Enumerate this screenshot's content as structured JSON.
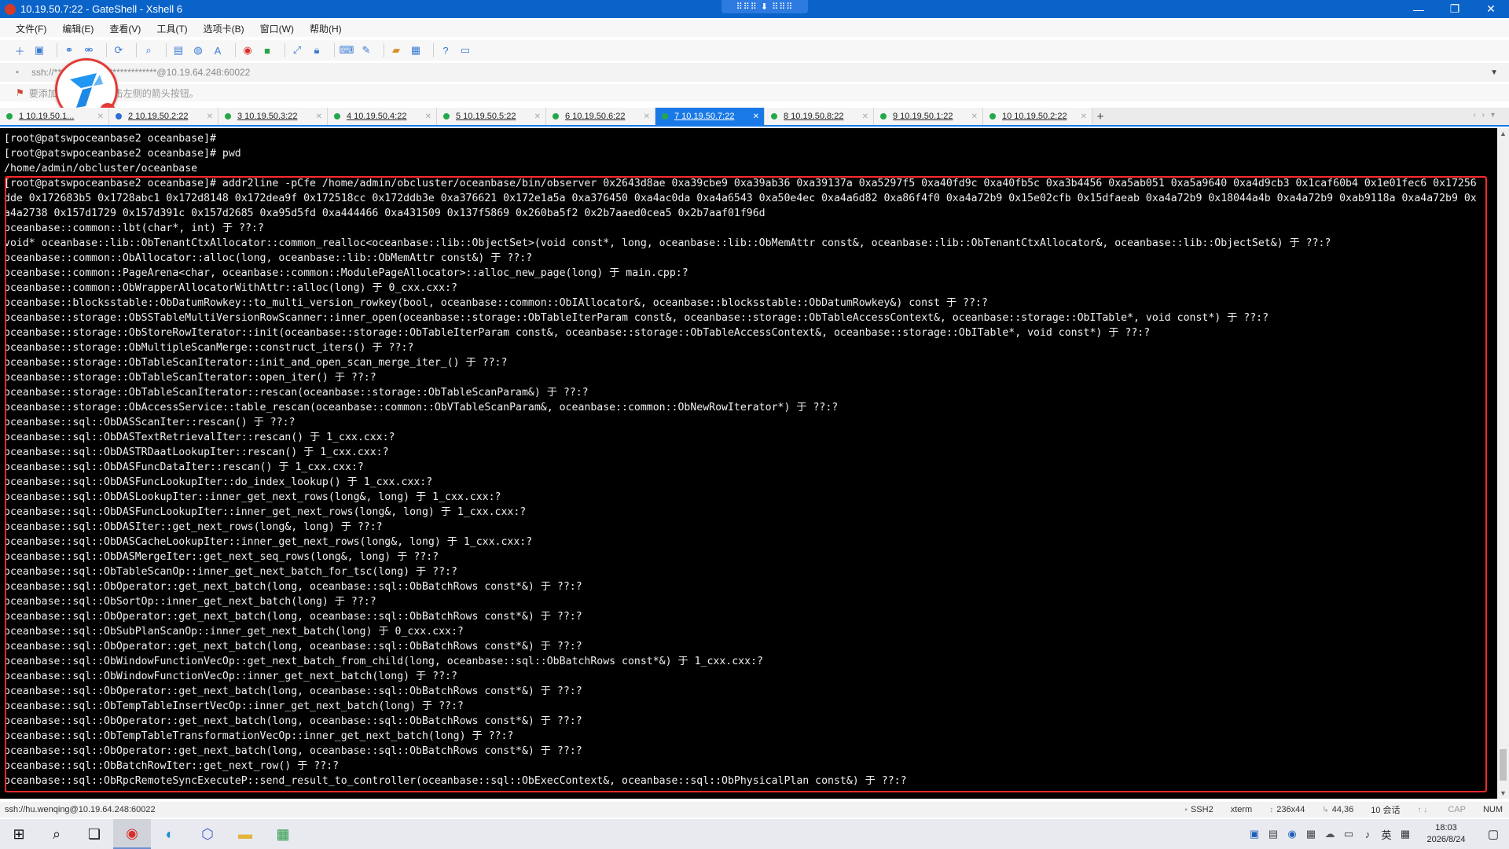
{
  "window": {
    "title": "10.19.50.7:22 - GateShell - Xshell 6",
    "grip": "⠿⠿⠿ ⬇ ⠿⠿⠿",
    "controls": [
      "—",
      "❐",
      "✕"
    ]
  },
  "menu": [
    "文件(F)",
    "编辑(E)",
    "查看(V)",
    "工具(T)",
    "选项卡(B)",
    "窗口(W)",
    "帮助(H)"
  ],
  "address": {
    "value": "ssh://****************************@10.19.64.248:60022"
  },
  "hint": {
    "text": "要添加当前会话，点击左侧的箭头按钮。"
  },
  "tabs": [
    {
      "label": "1 10.19.50.1...",
      "active": false,
      "warn": false
    },
    {
      "label": "2 10.19.50.2:22",
      "active": false,
      "warn": true
    },
    {
      "label": "3 10.19.50.3:22",
      "active": false,
      "warn": false
    },
    {
      "label": "4 10.19.50.4:22",
      "active": false,
      "warn": false
    },
    {
      "label": "5 10.19.50.5:22",
      "active": false,
      "warn": false
    },
    {
      "label": "6 10.19.50.6:22",
      "active": false,
      "warn": false
    },
    {
      "label": "7 10.19.50.7:22",
      "active": true,
      "warn": false
    },
    {
      "label": "8 10.19.50.8:22",
      "active": false,
      "warn": false
    },
    {
      "label": "9 10.19.50.1:22",
      "active": false,
      "warn": false
    },
    {
      "label": "10 10.19.50.2:22",
      "active": false,
      "warn": false
    }
  ],
  "terminal": {
    "lines": [
      "[root@patswpoceanbase2 oceanbase]#",
      "[root@patswpoceanbase2 oceanbase]# pwd",
      "/home/admin/obcluster/oceanbase",
      "[root@patswpoceanbase2 oceanbase]# addr2line -pCfe /home/admin/obcluster/oceanbase/bin/observer 0x2643d8ae 0xa39cbe9 0xa39ab36 0xa39137a 0xa5297f5 0xa40fd9c 0xa40fb5c 0xa3b4456 0xa5ab051 0xa5a9640 0xa4d9cb3 0x1caf60b4 0x1e01fec6 0x17256",
      "dde 0x172683b5 0x1728abc1 0x172d8148 0x172dea9f 0x172518cc 0x172ddb3e 0xa376621 0x172e1a5a 0xa376450 0xa4ac0da 0xa4a6543 0xa50e4ec 0xa4a6d82 0xa86f4f0 0xa4a72b9 0x15e02cfb 0x15dfaeab 0xa4a72b9 0x18044a4b 0xa4a72b9 0xab9118a 0xa4a72b9 0x",
      "a4a2738 0x157d1729 0x157d391c 0x157d2685 0xa95d5fd 0xa444466 0xa431509 0x137f5869 0x260ba5f2 0x2b7aaed0cea5 0x2b7aaf01f96d",
      "oceanbase::common::lbt(char*, int) 于 ??:?",
      "void* oceanbase::lib::ObTenantCtxAllocator::common_realloc<oceanbase::lib::ObjectSet>(void const*, long, oceanbase::lib::ObMemAttr const&, oceanbase::lib::ObTenantCtxAllocator&, oceanbase::lib::ObjectSet&) 于 ??:?",
      "oceanbase::common::ObAllocator::alloc(long, oceanbase::lib::ObMemAttr const&) 于 ??:?",
      "oceanbase::common::PageArena<char, oceanbase::common::ModulePageAllocator>::alloc_new_page(long) 于 main.cpp:?",
      "oceanbase::common::ObWrapperAllocatorWithAttr::alloc(long) 于 0_cxx.cxx:?",
      "oceanbase::blocksstable::ObDatumRowkey::to_multi_version_rowkey(bool, oceanbase::common::ObIAllocator&, oceanbase::blocksstable::ObDatumRowkey&) const 于 ??:?",
      "oceanbase::storage::ObSSTableMultiVersionRowScanner::inner_open(oceanbase::storage::ObTableIterParam const&, oceanbase::storage::ObTableAccessContext&, oceanbase::storage::ObITable*, void const*) 于 ??:?",
      "oceanbase::storage::ObStoreRowIterator::init(oceanbase::storage::ObTableIterParam const&, oceanbase::storage::ObTableAccessContext&, oceanbase::storage::ObITable*, void const*) 于 ??:?",
      "oceanbase::storage::ObMultipleScanMerge::construct_iters() 于 ??:?",
      "oceanbase::storage::ObTableScanIterator::init_and_open_scan_merge_iter_() 于 ??:?",
      "oceanbase::storage::ObTableScanIterator::open_iter() 于 ??:?",
      "oceanbase::storage::ObTableScanIterator::rescan(oceanbase::storage::ObTableScanParam&) 于 ??:?",
      "oceanbase::storage::ObAccessService::table_rescan(oceanbase::common::ObVTableScanParam&, oceanbase::common::ObNewRowIterator*) 于 ??:?",
      "oceanbase::sql::ObDASScanIter::rescan() 于 ??:?",
      "oceanbase::sql::ObDASTextRetrievalIter::rescan() 于 1_cxx.cxx:?",
      "oceanbase::sql::ObDASTRDaatLookupIter::rescan() 于 1_cxx.cxx:?",
      "oceanbase::sql::ObDASFuncDataIter::rescan() 于 1_cxx.cxx:?",
      "oceanbase::sql::ObDASFuncLookupIter::do_index_lookup() 于 1_cxx.cxx:?",
      "oceanbase::sql::ObDASLookupIter::inner_get_next_rows(long&, long) 于 1_cxx.cxx:?",
      "oceanbase::sql::ObDASFuncLookupIter::inner_get_next_rows(long&, long) 于 1_cxx.cxx:?",
      "oceanbase::sql::ObDASIter::get_next_rows(long&, long) 于 ??:?",
      "oceanbase::sql::ObDASCacheLookupIter::inner_get_next_rows(long&, long) 于 1_cxx.cxx:?",
      "oceanbase::sql::ObDASMergeIter::get_next_seq_rows(long&, long) 于 ??:?",
      "oceanbase::sql::ObTableScanOp::inner_get_next_batch_for_tsc(long) 于 ??:?",
      "oceanbase::sql::ObOperator::get_next_batch(long, oceanbase::sql::ObBatchRows const*&) 于 ??:?",
      "oceanbase::sql::ObSortOp::inner_get_next_batch(long) 于 ??:?",
      "oceanbase::sql::ObOperator::get_next_batch(long, oceanbase::sql::ObBatchRows const*&) 于 ??:?",
      "oceanbase::sql::ObSubPlanScanOp::inner_get_next_batch(long) 于 0_cxx.cxx:?",
      "oceanbase::sql::ObOperator::get_next_batch(long, oceanbase::sql::ObBatchRows const*&) 于 ??:?",
      "oceanbase::sql::ObWindowFunctionVecOp::get_next_batch_from_child(long, oceanbase::sql::ObBatchRows const*&) 于 1_cxx.cxx:?",
      "oceanbase::sql::ObWindowFunctionVecOp::inner_get_next_batch(long) 于 ??:?",
      "oceanbase::sql::ObOperator::get_next_batch(long, oceanbase::sql::ObBatchRows const*&) 于 ??:?",
      "oceanbase::sql::ObTempTableInsertVecOp::inner_get_next_batch(long) 于 ??:?",
      "oceanbase::sql::ObOperator::get_next_batch(long, oceanbase::sql::ObBatchRows const*&) 于 ??:?",
      "oceanbase::sql::ObTempTableTransformationVecOp::inner_get_next_batch(long) 于 ??:?",
      "oceanbase::sql::ObOperator::get_next_batch(long, oceanbase::sql::ObBatchRows const*&) 于 ??:?",
      "oceanbase::sql::ObBatchRowIter::get_next_row() 于 ??:?",
      "oceanbase::sql::ObRpcRemoteSyncExecuteP::send_result_to_controller(oceanbase::sql::ObExecContext&, oceanbase::sql::ObPhysicalPlan const&) 于 ??:?"
    ]
  },
  "statusbar": {
    "connection": "ssh://hu.wenqing@10.19.64.248:60022",
    "protocol": "SSH2",
    "term": "xterm",
    "size": "236x44",
    "cursor": "44,36",
    "sessions": "10 会话",
    "cap": "CAP",
    "num": "NUM"
  },
  "taskbar": {
    "ime": "英",
    "time": "18:03",
    "date": "2026/8/24"
  }
}
